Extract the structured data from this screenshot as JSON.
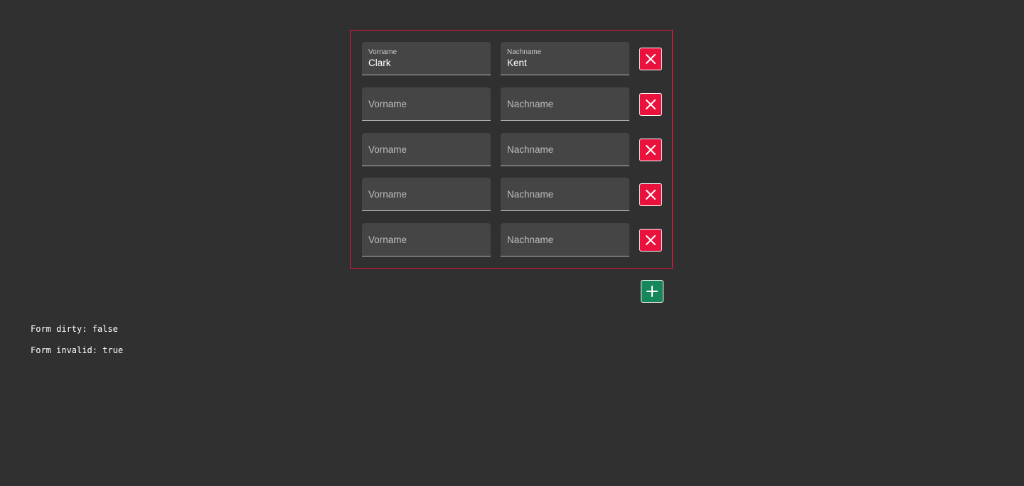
{
  "form": {
    "rows": [
      {
        "first_label": "Vorname",
        "first_value": "Clark",
        "last_label": "Nachname",
        "last_value": "Kent"
      },
      {
        "first_placeholder": "Vorname",
        "last_placeholder": "Nachname"
      },
      {
        "first_placeholder": "Vorname",
        "last_placeholder": "Nachname"
      },
      {
        "first_placeholder": "Vorname",
        "last_placeholder": "Nachname"
      },
      {
        "first_placeholder": "Vorname",
        "last_placeholder": "Nachname"
      }
    ],
    "remove_icon": "close-icon",
    "add_icon": "plus-icon"
  },
  "status": {
    "dirty": "Form dirty: false",
    "invalid": "Form invalid: true"
  },
  "colors": {
    "invalid_border": "#e8163e",
    "remove_button": "#ea123d",
    "add_button": "#15875a",
    "background": "#303030",
    "field": "#454545"
  }
}
